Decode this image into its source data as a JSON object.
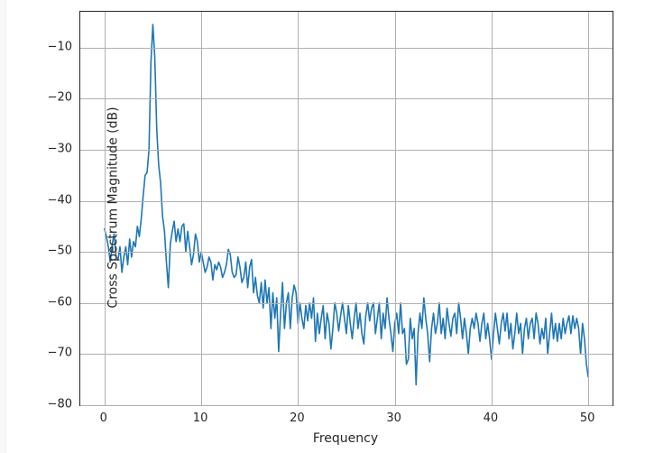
{
  "chart_data": {
    "type": "line",
    "title": "",
    "xlabel": "Frequency",
    "ylabel": "Cross Spectrum Magnitude (dB)",
    "xlim": [
      -2.5,
      52.5
    ],
    "ylim": [
      -80,
      -3
    ],
    "xticks": [
      0,
      10,
      20,
      30,
      40,
      50
    ],
    "yticks": [
      -80,
      -70,
      -60,
      -50,
      -40,
      -30,
      -20,
      -10
    ],
    "ytick_labels": [
      "−80",
      "−70",
      "−60",
      "−50",
      "−40",
      "−30",
      "−20",
      "−10"
    ],
    "line_color": "#1f77b4",
    "grid": true,
    "x": [
      0.0,
      0.2,
      0.4,
      0.6,
      0.8,
      1.0,
      1.2,
      1.4,
      1.6,
      1.8,
      2.0,
      2.2,
      2.4,
      2.6,
      2.8,
      3.0,
      3.2,
      3.4,
      3.6,
      3.8,
      4.0,
      4.2,
      4.4,
      4.6,
      4.8,
      5.0,
      5.2,
      5.4,
      5.6,
      5.8,
      6.0,
      6.2,
      6.4,
      6.6,
      6.8,
      7.0,
      7.2,
      7.4,
      7.6,
      7.8,
      8.0,
      8.2,
      8.4,
      8.6,
      8.8,
      9.0,
      9.2,
      9.4,
      9.6,
      9.8,
      10.0,
      10.2,
      10.4,
      10.6,
      10.8,
      11.0,
      11.2,
      11.4,
      11.6,
      11.8,
      12.0,
      12.2,
      12.4,
      12.6,
      12.8,
      13.0,
      13.2,
      13.4,
      13.6,
      13.8,
      14.0,
      14.2,
      14.4,
      14.6,
      14.8,
      15.0,
      15.2,
      15.4,
      15.6,
      15.8,
      16.0,
      16.2,
      16.4,
      16.6,
      16.8,
      17.0,
      17.2,
      17.4,
      17.6,
      17.8,
      18.0,
      18.2,
      18.4,
      18.6,
      18.8,
      19.0,
      19.2,
      19.4,
      19.6,
      19.8,
      20.0,
      20.2,
      20.4,
      20.6,
      20.8,
      21.0,
      21.2,
      21.4,
      21.6,
      21.8,
      22.0,
      22.2,
      22.4,
      22.6,
      22.8,
      23.0,
      23.2,
      23.4,
      23.6,
      23.8,
      24.0,
      24.2,
      24.4,
      24.6,
      24.8,
      25.0,
      25.2,
      25.4,
      25.6,
      25.8,
      26.0,
      26.2,
      26.4,
      26.6,
      26.8,
      27.0,
      27.2,
      27.4,
      27.6,
      27.8,
      28.0,
      28.2,
      28.4,
      28.6,
      28.8,
      29.0,
      29.2,
      29.4,
      29.6,
      29.8,
      30.0,
      30.2,
      30.4,
      30.6,
      30.8,
      31.0,
      31.2,
      31.4,
      31.6,
      31.8,
      32.0,
      32.2,
      32.4,
      32.6,
      32.8,
      33.0,
      33.2,
      33.4,
      33.6,
      33.8,
      34.0,
      34.2,
      34.4,
      34.6,
      34.8,
      35.0,
      35.2,
      35.4,
      35.6,
      35.8,
      36.0,
      36.2,
      36.4,
      36.6,
      36.8,
      37.0,
      37.2,
      37.4,
      37.6,
      37.8,
      38.0,
      38.2,
      38.4,
      38.6,
      38.8,
      39.0,
      39.2,
      39.4,
      39.6,
      39.8,
      40.0,
      40.2,
      40.4,
      40.6,
      40.8,
      41.0,
      41.2,
      41.4,
      41.6,
      41.8,
      42.0,
      42.2,
      42.4,
      42.6,
      42.8,
      43.0,
      43.2,
      43.4,
      43.6,
      43.8,
      44.0,
      44.2,
      44.4,
      44.6,
      44.8,
      45.0,
      45.2,
      45.4,
      45.6,
      45.8,
      46.0,
      46.2,
      46.4,
      46.6,
      46.8,
      47.0,
      47.2,
      47.4,
      47.6,
      47.8,
      48.0,
      48.2,
      48.4,
      48.6,
      48.8,
      49.0,
      49.2,
      49.4,
      49.6,
      49.8,
      50.0
    ],
    "y": [
      -45.5,
      -47.0,
      -49.0,
      -52.0,
      -48.5,
      -46.5,
      -51.0,
      -51.5,
      -49.0,
      -54.0,
      -51.0,
      -49.0,
      -52.5,
      -47.5,
      -51.0,
      -48.0,
      -49.0,
      -45.0,
      -47.0,
      -43.5,
      -39.0,
      -35.0,
      -34.5,
      -30.0,
      -13.0,
      -5.5,
      -12.0,
      -26.0,
      -33.0,
      -36.5,
      -43.0,
      -46.0,
      -52.0,
      -57.0,
      -48.5,
      -46.0,
      -44.0,
      -48.0,
      -45.5,
      -48.0,
      -45.0,
      -44.5,
      -50.0,
      -46.0,
      -49.0,
      -52.5,
      -50.5,
      -46.5,
      -48.0,
      -52.0,
      -50.0,
      -52.0,
      -54.0,
      -53.0,
      -51.0,
      -52.0,
      -55.5,
      -52.5,
      -53.5,
      -52.0,
      -53.0,
      -55.0,
      -54.0,
      -52.5,
      -49.5,
      -50.5,
      -54.0,
      -55.0,
      -54.5,
      -51.0,
      -53.0,
      -56.0,
      -55.0,
      -52.0,
      -57.0,
      -53.0,
      -51.5,
      -58.0,
      -55.0,
      -58.5,
      -60.0,
      -56.0,
      -61.0,
      -55.5,
      -60.0,
      -57.0,
      -65.0,
      -58.0,
      -63.0,
      -59.0,
      -69.5,
      -62.0,
      -56.0,
      -65.0,
      -60.0,
      -58.0,
      -65.0,
      -59.0,
      -56.5,
      -58.0,
      -64.0,
      -60.0,
      -63.0,
      -65.0,
      -60.5,
      -63.5,
      -60.0,
      -63.0,
      -59.0,
      -67.5,
      -62.0,
      -66.0,
      -63.0,
      -60.5,
      -67.0,
      -62.0,
      -64.0,
      -69.0,
      -65.0,
      -60.0,
      -62.0,
      -65.5,
      -62.5,
      -60.0,
      -63.0,
      -66.0,
      -60.5,
      -64.0,
      -67.0,
      -63.0,
      -60.0,
      -65.0,
      -62.0,
      -66.0,
      -68.0,
      -62.5,
      -60.0,
      -63.5,
      -61.0,
      -60.0,
      -66.0,
      -63.0,
      -60.0,
      -67.0,
      -62.0,
      -65.0,
      -59.0,
      -63.0,
      -66.0,
      -69.5,
      -64.0,
      -62.0,
      -66.0,
      -60.0,
      -66.0,
      -65.0,
      -72.0,
      -71.0,
      -63.0,
      -67.0,
      -65.0,
      -76.0,
      -66.0,
      -62.0,
      -65.0,
      -59.0,
      -63.0,
      -66.0,
      -71.5,
      -65.0,
      -62.0,
      -66.0,
      -64.0,
      -60.0,
      -66.0,
      -63.0,
      -67.0,
      -61.0,
      -64.0,
      -66.5,
      -63.0,
      -62.0,
      -66.0,
      -60.0,
      -63.0,
      -67.0,
      -63.0,
      -66.0,
      -70.0,
      -65.0,
      -63.0,
      -65.0,
      -62.0,
      -64.0,
      -67.5,
      -64.0,
      -62.0,
      -67.0,
      -64.0,
      -67.0,
      -71.0,
      -66.0,
      -62.0,
      -65.0,
      -68.0,
      -64.0,
      -62.0,
      -65.5,
      -62.0,
      -67.0,
      -64.0,
      -69.0,
      -66.0,
      -62.0,
      -66.0,
      -64.0,
      -70.0,
      -65.0,
      -63.0,
      -67.0,
      -64.0,
      -63.0,
      -67.0,
      -62.0,
      -64.0,
      -68.0,
      -65.0,
      -67.0,
      -63.0,
      -70.0,
      -66.0,
      -62.0,
      -67.0,
      -64.0,
      -67.5,
      -64.0,
      -67.0,
      -63.0,
      -66.0,
      -64.0,
      -62.5,
      -66.0,
      -62.5,
      -65.0,
      -63.0,
      -65.0,
      -70.0,
      -64.0,
      -67.0,
      -72.0,
      -74.5
    ]
  }
}
